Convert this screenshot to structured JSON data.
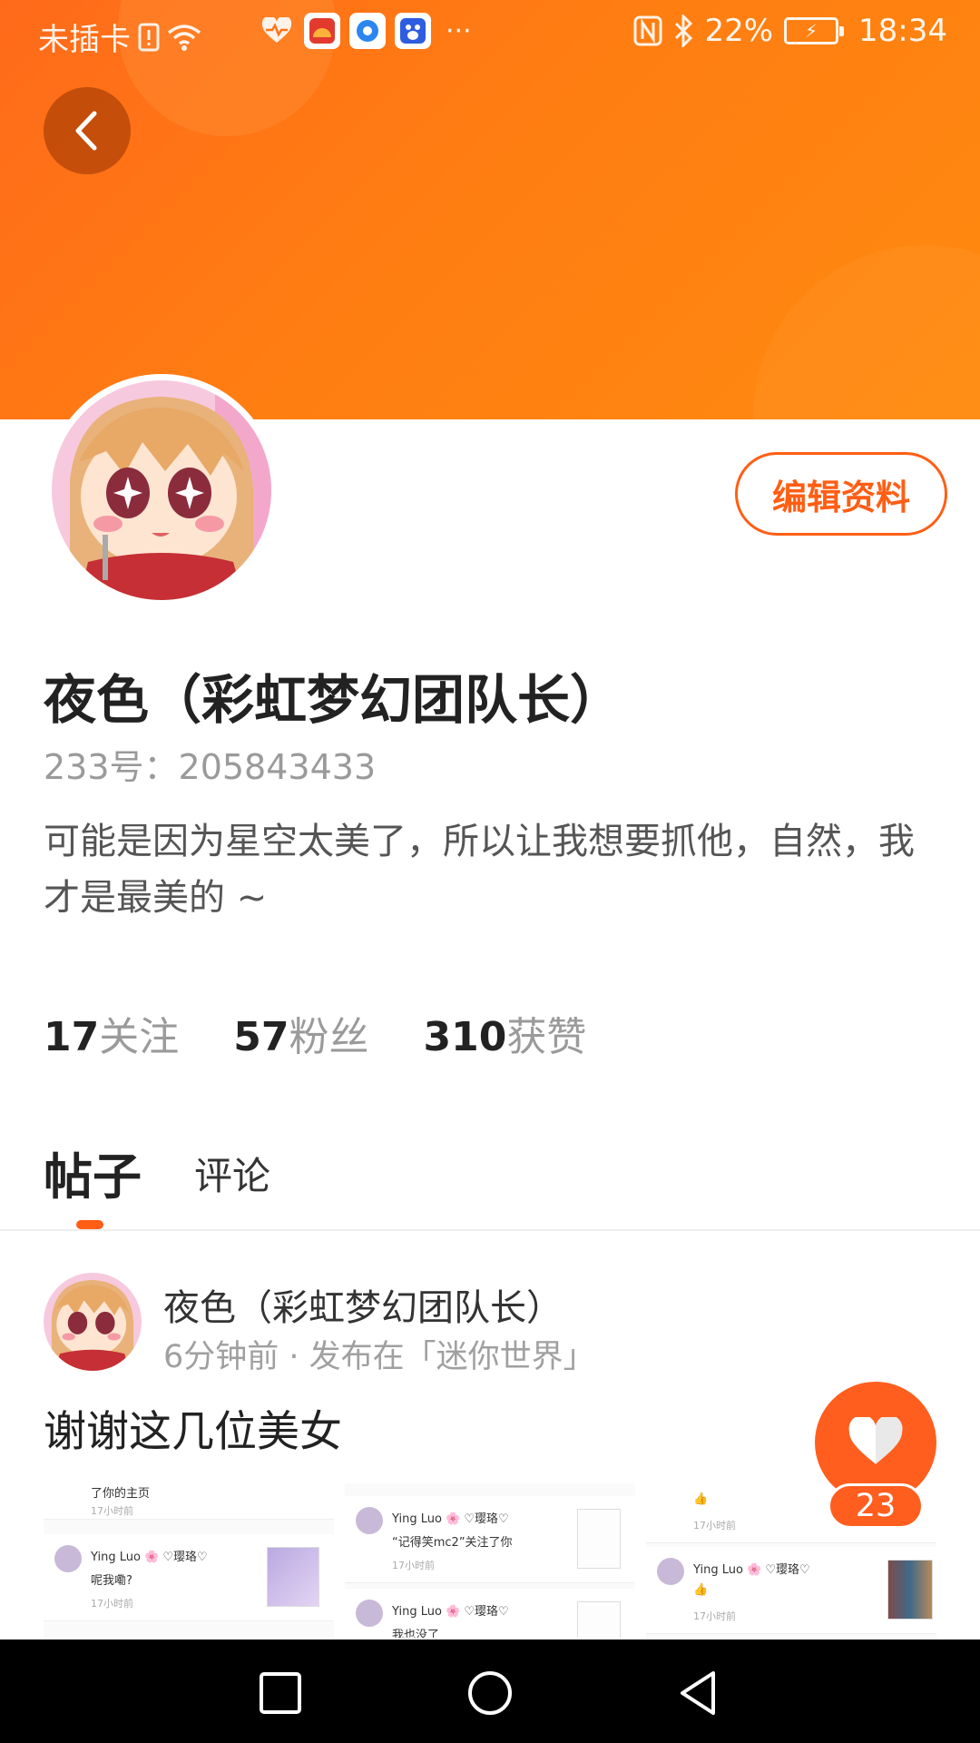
{
  "status_bar": {
    "carrier": "未插卡",
    "battery": "22%",
    "time": "18:34",
    "icons": [
      "sim-alert-icon",
      "wifi-icon",
      "heart-rate-icon",
      "app-icon",
      "browser-icon",
      "baidu-icon",
      "more-dots-icon",
      "nfc-icon",
      "bluetooth-icon",
      "battery-charging-icon"
    ]
  },
  "header": {
    "back_icon": "chevron-left-icon",
    "accent_color": "#ff6a1a"
  },
  "profile": {
    "edit_label": "编辑资料",
    "nickname": "夜色（彩虹梦幻团队长）",
    "uid": "233号：205843433",
    "bio": "可能是因为星空太美了，所以让我想要抓他，自然，我才是最美的 ~",
    "stats": [
      {
        "num": "17",
        "label": "关注"
      },
      {
        "num": "57",
        "label": "粉丝"
      },
      {
        "num": "310",
        "label": "获赞"
      }
    ]
  },
  "tabs": {
    "posts": "帖子",
    "comments": "评论"
  },
  "post": {
    "author": "夜色（彩虹梦幻团队长）",
    "meta": "6分钟前 · 发布在「迷你世界」",
    "text": "谢谢这几位美女",
    "images": [
      {
        "name": "Ying Luo 🌸 ♡璎珞♡",
        "msg": "呢我嘞?",
        "time": "17小时前",
        "top_msg": "了你的主页"
      },
      {
        "name": "Ying Luo 🌸 ♡璎珞♡",
        "msg": "“记得笑mc2”关注了你",
        "time": "17小时前",
        "top_msg": "我也没了"
      },
      {
        "name": "Ying Luo 🌸 ♡璎珞♡",
        "msg": "👍",
        "time": "17小时前",
        "top_msg": "👍"
      }
    ],
    "like_count": "23"
  },
  "nav": {
    "icons": [
      "recents-square-icon",
      "home-circle-icon",
      "back-triangle-icon"
    ]
  }
}
